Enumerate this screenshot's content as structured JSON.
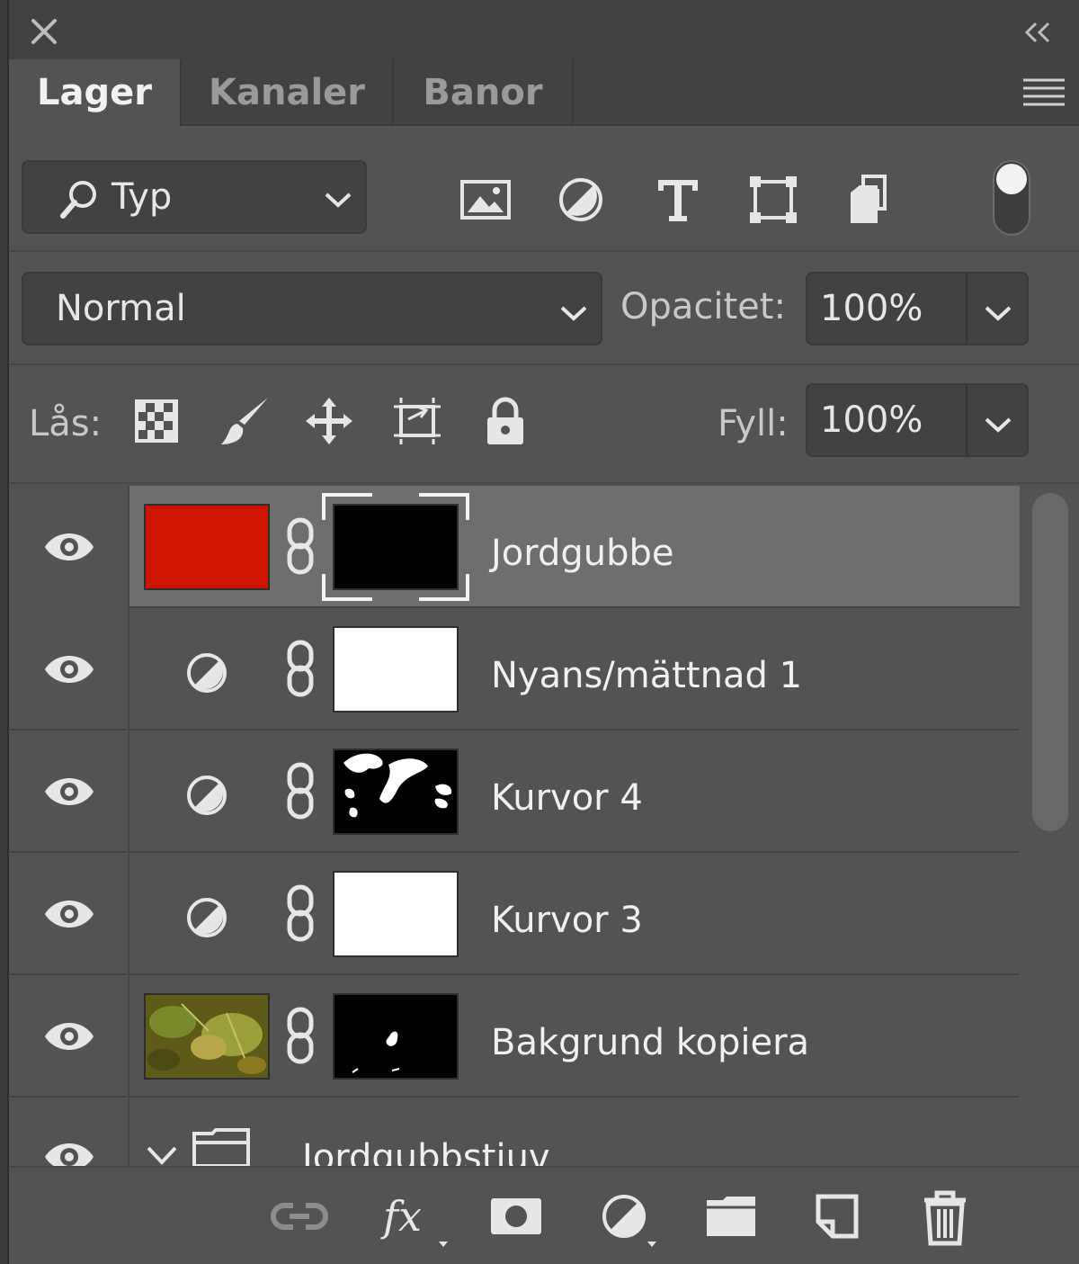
{
  "tabs": [
    {
      "label": "Lager",
      "active": true
    },
    {
      "label": "Kanaler",
      "active": false
    },
    {
      "label": "Banor",
      "active": false
    }
  ],
  "filter": {
    "kind_label": "Typ",
    "icons": [
      "pixel-layer-filter-icon",
      "adjustment-layer-filter-icon",
      "type-layer-filter-icon",
      "shape-layer-filter-icon",
      "smart-object-filter-icon"
    ],
    "toggle_on": true
  },
  "blend": {
    "mode": "Normal",
    "opacity_label": "Opacitet:",
    "opacity": "100%"
  },
  "lock": {
    "label": "Lås:",
    "icons": [
      "lock-transparency-icon",
      "lock-image-pixels-icon",
      "lock-position-icon",
      "prevent-autonest-icon",
      "lock-all-icon"
    ],
    "fill_label": "Fyll:",
    "fill": "100%"
  },
  "layers": [
    {
      "name": "Jordgubbe",
      "type": "color-fill",
      "color": "#cf1500",
      "mask": "black",
      "selected": true
    },
    {
      "name": "Nyans/mättnad 1",
      "type": "adjustment",
      "mask": "white"
    },
    {
      "name": "Kurvor 4",
      "type": "adjustment",
      "mask": "black-with-white-shapes"
    },
    {
      "name": "Kurvor 3",
      "type": "adjustment",
      "mask": "white"
    },
    {
      "name": "Bakgrund kopiera",
      "type": "image",
      "mask": "black-with-small-white-shape"
    },
    {
      "name": "Jordgubbstjuv",
      "type": "group",
      "expanded": true
    }
  ],
  "bottom_bar": [
    "link-layers-icon",
    "fx-icon",
    "add-mask-icon",
    "new-adjustment-icon",
    "new-group-icon",
    "new-layer-icon",
    "trash-icon"
  ],
  "colors": {
    "panel": "#535353",
    "header": "#424242",
    "selected_row": "#6e6e6e",
    "fill_red": "#cf1500"
  }
}
